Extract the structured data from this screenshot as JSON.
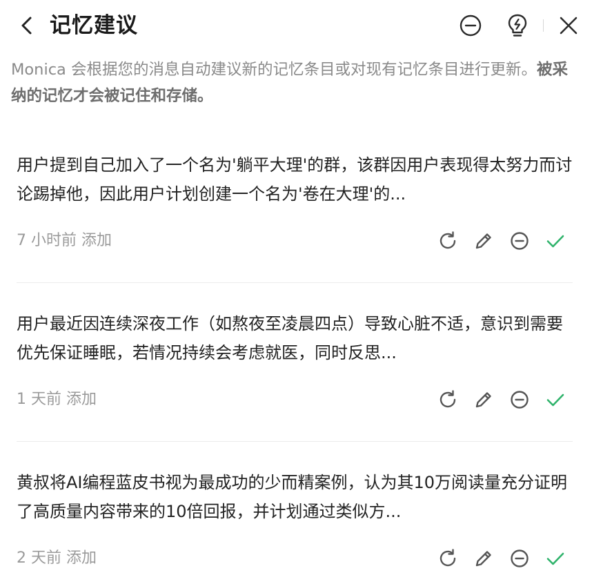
{
  "header": {
    "title": "记忆建议",
    "back_icon": "chevron-left-icon",
    "minus_icon": "minus-circle-icon",
    "bolt_icon": "lightbulb-bolt-icon",
    "close_icon": "close-icon"
  },
  "description": {
    "normal": "Monica 会根据您的消息自动建议新的记忆条目或对现有记忆条目进行更新。",
    "bold": "被采纳的记忆才会被记住和存储。"
  },
  "colors": {
    "accept_green": "#2fb36b",
    "icon_gray": "#555555",
    "meta_gray": "#9a9a9a"
  },
  "memories": [
    {
      "text": "用户提到自己加入了一个名为'躺平大理'的群，该群因用户表现得太努力而讨论踢掉他，因此用户计划创建一个名为'卷在大理'的...",
      "time": "7 小时前 添加"
    },
    {
      "text": "用户最近因连续深夜工作（如熬夜至凌晨四点）导致心脏不适，意识到需要优先保证睡眠，若情况持续会考虑就医，同时反思...",
      "time": "1 天前 添加"
    },
    {
      "text": "黄叔将AI编程蓝皮书视为最成功的少而精案例，认为其10万阅读量充分证明了高质量内容带来的10倍回报，并计划通过类似方...",
      "time": "2 天前 添加"
    }
  ]
}
